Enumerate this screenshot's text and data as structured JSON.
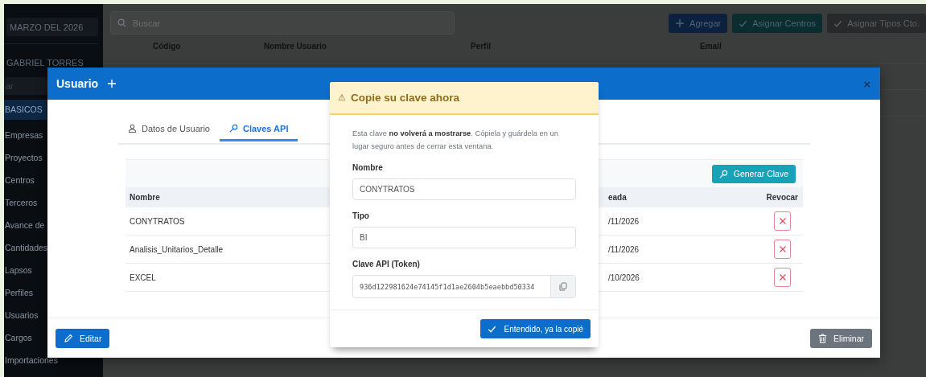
{
  "sidebar": {
    "period": "MARZO DEL 2026",
    "user": "GABRIEL TORRES",
    "search": {
      "placeholder": "ar"
    },
    "items": [
      {
        "label": "BASICOS",
        "selected": true
      },
      {
        "label": "Empresas",
        "selected": false
      },
      {
        "label": "Proyectos",
        "selected": false
      },
      {
        "label": "Centros",
        "selected": false
      },
      {
        "label": "Terceros",
        "selected": false
      },
      {
        "label": "Avance de",
        "selected": false
      },
      {
        "label": "Cantidades",
        "selected": false
      },
      {
        "label": "Lapsos",
        "selected": false
      },
      {
        "label": "Perfiles",
        "selected": false
      },
      {
        "label": "Usuarios",
        "selected": false
      },
      {
        "label": "Cargos",
        "selected": false
      },
      {
        "label": "Importaciones",
        "selected": false
      }
    ]
  },
  "toolbar": {
    "search": {
      "placeholder": "Buscar"
    },
    "buttons": [
      {
        "label": "Agregar",
        "kind": "add"
      },
      {
        "label": "Asignar Centros",
        "kind": "assign-centers"
      },
      {
        "label": "Asignar Tipos Cto.",
        "kind": "assign-types"
      }
    ]
  },
  "table": {
    "columns": [
      "Código",
      "Nombre Usuario",
      "Perfil",
      "Email"
    ]
  },
  "modal": {
    "title": "Usuario",
    "close": "×",
    "tabs": [
      {
        "label": "Datos de Usuario",
        "selected": false
      },
      {
        "label": "Claves API",
        "selected": true
      }
    ],
    "generate_button": "Generar Clave",
    "keys_table": {
      "columns": [
        "Nombre",
        "eada",
        "Revocar"
      ],
      "rows": [
        {
          "name": "CONYTRATOS",
          "created": "/11/2026"
        },
        {
          "name": "Analisis_Unitarios_Detalle",
          "created": "/11/2026"
        },
        {
          "name": "EXCEL",
          "created": "/10/2026"
        }
      ]
    },
    "edit_button": "Editar",
    "delete_button": "Eliminar"
  },
  "alert": {
    "icon": "⚠",
    "title": "Copie su clave ahora",
    "message": "Esta clave **no volverá a mostrarse**. Cópiela y guárdela en un lugar seguro antes de cerrar esta ventana.",
    "fields": [
      {
        "label": "Nombre",
        "value": "CONYTRATOS",
        "kind": "text"
      },
      {
        "label": "Tipo",
        "value": "BI",
        "kind": "text"
      },
      {
        "label": "Clave API (Token)",
        "value": "936d122981624e74145f1d1ae2604b5eaebbd50334",
        "kind": "token"
      }
    ],
    "confirm_button": "Entendido, ya la copié"
  }
}
